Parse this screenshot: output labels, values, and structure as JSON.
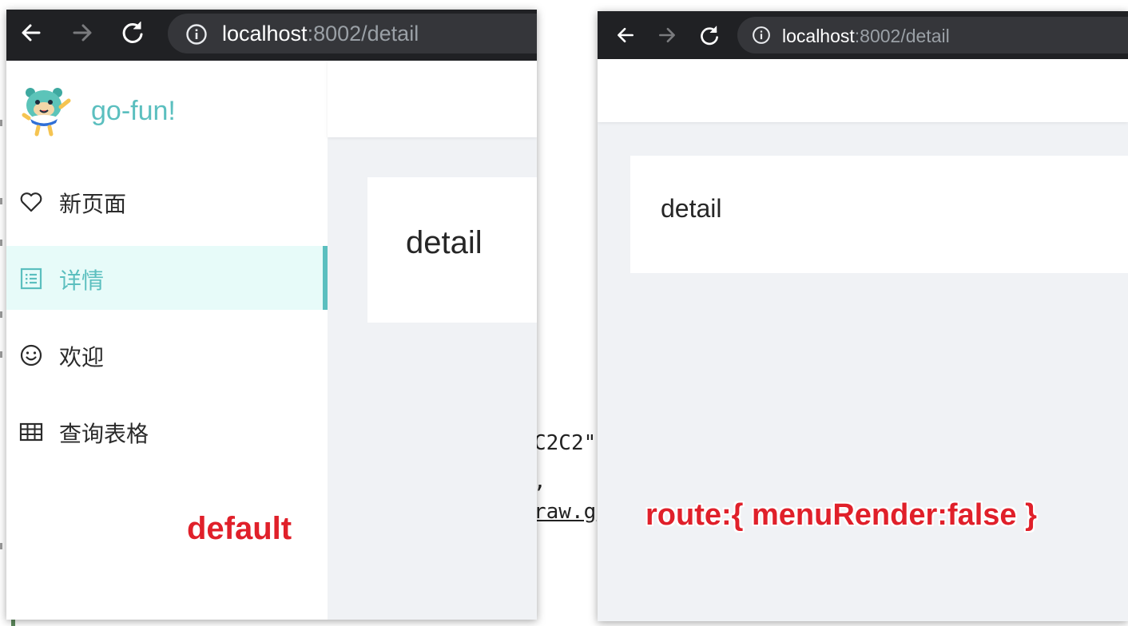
{
  "background_code": {
    "line1": "C2C2\"",
    "line2": ",",
    "line3": "raw.g",
    "line4": " "
  },
  "left_window": {
    "url_host": "localhost",
    "url_path": ":8002/detail",
    "brand": "go-fun!",
    "menu": [
      {
        "label": "新页面",
        "icon": "heart-icon"
      },
      {
        "label": "详情",
        "icon": "list-detail-icon",
        "active": true
      },
      {
        "label": "欢迎",
        "icon": "smile-icon"
      },
      {
        "label": "查询表格",
        "icon": "table-icon"
      }
    ],
    "card_text": "detail",
    "annotation": "default"
  },
  "right_window": {
    "url_host": "localhost",
    "url_path": ":8002/detail",
    "card_text": "detail",
    "annotation": "route:{ menuRender:false }"
  },
  "colors": {
    "accent": "#5bbfbf",
    "active_bg": "#e7fbf9",
    "annotation": "#e0202a",
    "toolbar": "#202124",
    "content_bg": "#f0f2f5"
  }
}
